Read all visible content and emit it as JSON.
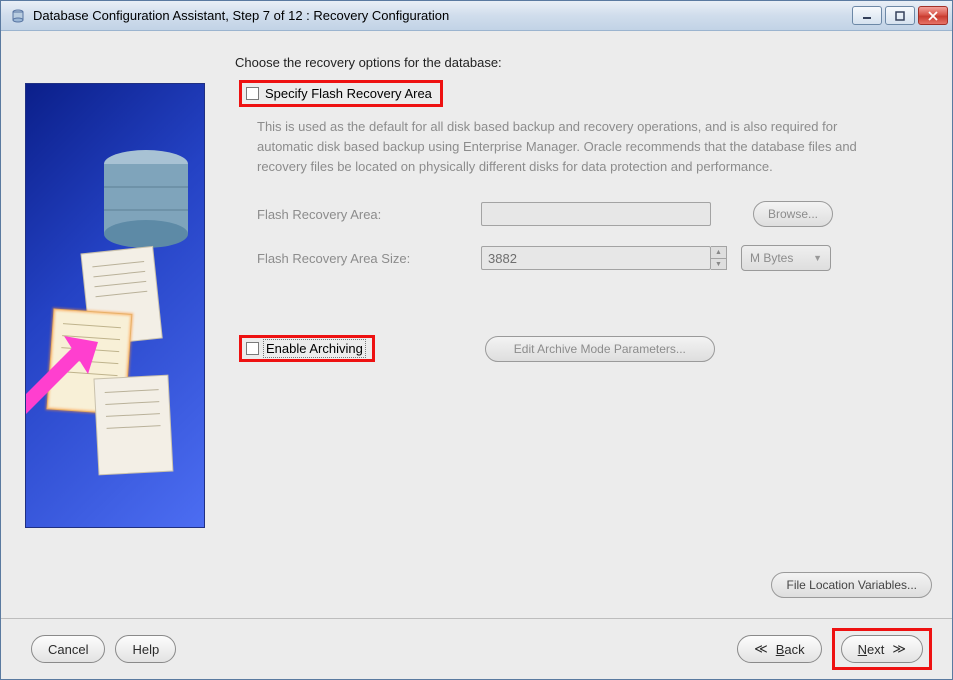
{
  "window": {
    "title": "Database Configuration Assistant, Step 7 of 12 : Recovery Configuration"
  },
  "main": {
    "heading": "Choose the recovery options for the database:",
    "flash_checkbox_label": "Specify Flash Recovery Area",
    "description": "This is used as the default for all disk based backup and recovery operations, and is also required for automatic disk based backup using Enterprise Manager. Oracle recommends that the database files and recovery files be located on physically different disks for data protection and performance.",
    "fra_label": "Flash Recovery Area:",
    "fra_value": "",
    "browse_label": "Browse...",
    "fra_size_label": "Flash Recovery Area Size:",
    "fra_size_value": "3882",
    "fra_size_unit": "M Bytes",
    "archive_checkbox_label": "Enable Archiving",
    "archive_params_btn": "Edit Archive Mode Parameters...",
    "file_loc_btn": "File Location Variables..."
  },
  "footer": {
    "cancel": "Cancel",
    "help": "Help",
    "back": "Back",
    "next": "Next"
  }
}
